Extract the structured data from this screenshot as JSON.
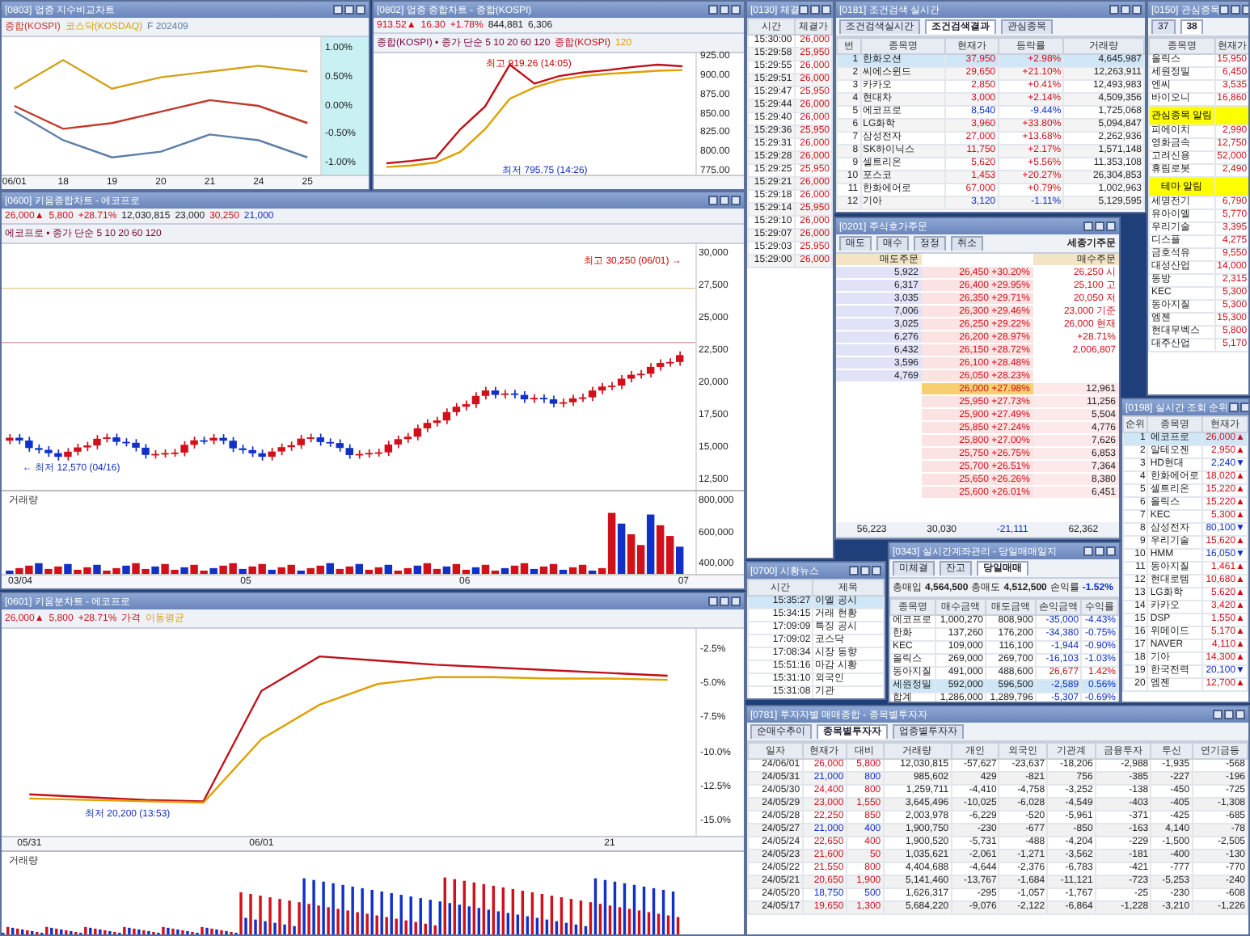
{
  "compare_chart": {
    "title": "[0803] 업종 지수비교차트",
    "chart_data": {
      "type": "line",
      "categories": [
        "06/01",
        "18",
        "19",
        "20",
        "21",
        "24",
        "25"
      ],
      "ylim": [
        -1.2,
        1.2
      ],
      "yticks": [
        {
          "value": 1,
          "label": "1.00%"
        },
        {
          "value": 0.5,
          "label": "0.50%"
        },
        {
          "value": 0,
          "label": "0.00%"
        },
        {
          "value": -0.5,
          "label": "-0.50%"
        },
        {
          "value": -1,
          "label": "-1.00%"
        }
      ],
      "series": [
        {
          "name": "종합(KOSPI)",
          "color": "#c0392b",
          "values": [
            0.0,
            -0.4,
            -0.3,
            -0.1,
            0.1,
            0.0,
            -0.3
          ]
        },
        {
          "name": "코스닥(KOSDAQ)",
          "color": "#d4a017",
          "values": [
            0.3,
            0.8,
            0.3,
            0.5,
            0.6,
            0.7,
            0.6
          ]
        },
        {
          "name": "F 202409",
          "color": "#5d7fa6",
          "values": [
            -0.1,
            -0.6,
            -0.9,
            -0.8,
            -0.5,
            -0.6,
            -0.9
          ]
        }
      ]
    }
  },
  "index_chart": {
    "title": "[0802] 업종 종합차트 - 종합(KOSPI)",
    "quote": [
      "913.52▲",
      "16.30",
      "+1.78%",
      "844,881",
      "6,306"
    ],
    "legend": "종합(KOSPI) ▪ 종가 단순 5 10 20 60 120",
    "high": "최고 919.26 (14:05)",
    "low": "최저 795.75 (14:26)",
    "chart_data": {
      "type": "line",
      "categories": [
        null,
        null,
        null,
        null,
        null,
        null,
        null,
        null,
        null,
        null,
        null,
        null,
        null
      ],
      "ylim": [
        770,
        930
      ],
      "yticks": [
        {
          "value": 925,
          "label": "925.00"
        },
        {
          "value": 900,
          "label": "900.00"
        },
        {
          "value": 875,
          "label": "875.00"
        },
        {
          "value": 850,
          "label": "850.00"
        },
        {
          "value": 825,
          "label": "825.00"
        },
        {
          "value": 800,
          "label": "800.00"
        },
        {
          "value": 775,
          "label": "775.00"
        }
      ],
      "series": [
        {
          "name": "종합(KOSPI)",
          "color": "#c0101a",
          "values": [
            785,
            788,
            792,
            830,
            860,
            915,
            890,
            900,
            905,
            908,
            912,
            915,
            913
          ]
        },
        {
          "name": "120",
          "color": "#e0a000",
          "values": [
            780,
            782,
            786,
            800,
            830,
            870,
            885,
            895,
            900,
            903,
            905,
            907,
            908
          ]
        }
      ]
    }
  },
  "stock_chart": {
    "title": "[0600] 키움종합차트 - 에코프로",
    "quote": [
      "26,000▲",
      "5,800",
      "+28.71%",
      "12,030,815",
      "23,000",
      "30,250",
      "21,000"
    ],
    "legend": "에코프로 ▪ 종가 단순 5 10 20 60 120",
    "yticks": [
      "30,000",
      "27,500",
      "25,000",
      "22,500",
      "20,000",
      "17,500",
      "15,000",
      "12,500"
    ],
    "high": "최고 30,250 (06/01) →",
    "low": "← 최저 12,570 (04/16)",
    "volume_label": "거래량",
    "volume_ticks": [
      "800,000",
      "600,000",
      "400,000"
    ],
    "xticks": [
      "03/04",
      "05",
      "06",
      "07"
    ]
  },
  "minute_chart": {
    "title": "[0601] 키움분차트 - 에코프로",
    "quote": [
      "26,000▲",
      "5,800",
      "+28.71%"
    ],
    "low": "최저 20,200 (13:53)",
    "volume_label": "거래량",
    "chart_data": {
      "type": "line",
      "categories": [
        "05/31",
        null,
        null,
        null,
        "06/01",
        null,
        null,
        null,
        null,
        null,
        "21",
        null
      ],
      "ylim": [
        -16,
        -1
      ],
      "yticks": [
        {
          "value": -2.5,
          "label": "-2.5%"
        },
        {
          "value": -5,
          "label": "-5.0%"
        },
        {
          "value": -7.5,
          "label": "-7.5%"
        },
        {
          "value": -10,
          "label": "-10.0%"
        },
        {
          "value": -12.5,
          "label": "-12.5%"
        },
        {
          "value": -15,
          "label": "-15.0%"
        }
      ],
      "series": [
        {
          "name": "가격",
          "color": "#c0101a",
          "values": [
            -13.0,
            -13.2,
            -13.4,
            -13.5,
            -5.5,
            -3.0,
            -3.3,
            -3.6,
            -3.8,
            -4.0,
            -4.2,
            -4.4
          ]
        },
        {
          "name": "이동평균",
          "color": "#e0a000",
          "values": [
            -13.3,
            -13.4,
            -13.5,
            -13.6,
            -9.0,
            -6.5,
            -5.0,
            -4.5,
            -4.5,
            -4.6,
            -4.6,
            -4.7
          ]
        }
      ]
    }
  },
  "trades": {
    "title": "[0130] 체결",
    "columns": [
      "시간",
      "체결가"
    ],
    "rows": [
      [
        "15:30:00",
        "26,000"
      ],
      [
        "15:29:58",
        "25,950"
      ],
      [
        "15:29:55",
        "26,000"
      ],
      [
        "15:29:51",
        "26,000"
      ],
      [
        "15:29:47",
        "25,950"
      ],
      [
        "15:29:44",
        "26,000"
      ],
      [
        "15:29:40",
        "26,000"
      ],
      [
        "15:29:36",
        "25,950"
      ],
      [
        "15:29:31",
        "26,000"
      ],
      [
        "15:29:28",
        "26,000"
      ],
      [
        "15:29:25",
        "25,950"
      ],
      [
        "15:29:21",
        "26,000"
      ],
      [
        "15:29:18",
        "26,000"
      ],
      [
        "15:29:14",
        "25,950"
      ],
      [
        "15:29:10",
        "26,000"
      ],
      [
        "15:29:07",
        "26,000"
      ],
      [
        "15:29:03",
        "25,950"
      ],
      [
        "15:29:00",
        "26,000"
      ]
    ]
  },
  "ranking": {
    "title": "[0181] 조건검색 실시간",
    "tabs": [
      {
        "label": "조건검색실시간",
        "selected": false
      },
      {
        "label": "조건검색결과",
        "selected": true
      },
      {
        "label": "관심종목",
        "selected": false
      }
    ],
    "columns": [
      "번",
      "종목명",
      "현재가",
      "등락률",
      "거래량"
    ],
    "rows": [
      {
        "cells": [
          "1",
          "한화오션",
          "37,950",
          "+2.98%",
          "4,645,987"
        ],
        "color": "#d0101a",
        "selected": true
      },
      {
        "cells": [
          "2",
          "씨에스윈드",
          "29,650",
          "+21.10%",
          "12,263,911"
        ],
        "color": "#d0101a",
        "selected": false
      },
      {
        "cells": [
          "3",
          "카카오",
          "2,850",
          "+0.41%",
          "12,493,983"
        ],
        "color": "#d0101a",
        "selected": false
      },
      {
        "cells": [
          "4",
          "현대차",
          "3,000",
          "+2.14%",
          "4,509,356"
        ],
        "color": "#d0101a",
        "selected": false
      },
      {
        "cells": [
          "5",
          "에코프로",
          "8,540",
          "-9.44%",
          "1,725,068"
        ],
        "color": "#1030c8",
        "selected": false
      },
      {
        "cells": [
          "6",
          "LG화학",
          "3,960",
          "+33.80%",
          "5,094,847"
        ],
        "color": "#d0101a",
        "selected": false
      },
      {
        "cells": [
          "7",
          "삼성전자",
          "27,000",
          "+13.68%",
          "2,262,936"
        ],
        "color": "#d0101a",
        "selected": false
      },
      {
        "cells": [
          "8",
          "SK하이닉스",
          "11,750",
          "+2.17%",
          "1,571,148"
        ],
        "color": "#d0101a",
        "selected": false
      },
      {
        "cells": [
          "9",
          "셀트리온",
          "5,620",
          "+5.56%",
          "11,353,108"
        ],
        "color": "#d0101a",
        "selected": false
      },
      {
        "cells": [
          "10",
          "포스코",
          "1,453",
          "+20.27%",
          "26,304,853"
        ],
        "color": "#d0101a",
        "selected": false
      },
      {
        "cells": [
          "11",
          "한화에어로",
          "67,000",
          "+0.79%",
          "1,002,963"
        ],
        "color": "#d0101a",
        "selected": false
      },
      {
        "cells": [
          "12",
          "기아",
          "3,120",
          "-1.11%",
          "5,129,595"
        ],
        "color": "#1030c8",
        "selected": false
      }
    ]
  },
  "watchlist": {
    "title": "[0150] 관심종목",
    "tabs": [
      {
        "label": "37",
        "selected": false
      },
      {
        "label": "38",
        "selected": true
      }
    ],
    "columns": [
      "종목명",
      "현재가"
    ],
    "rows": [
      {
        "kind": "stock",
        "cells": [
          "올릭스",
          "15,950"
        ],
        "color": "#d0101a"
      },
      {
        "kind": "stock",
        "cells": [
          "세원정밀",
          "6,450"
        ],
        "color": "#d0101a"
      },
      {
        "kind": "stock",
        "cells": [
          "엔씨",
          "3,535"
        ],
        "color": "#d0101a"
      },
      {
        "kind": "stock",
        "cells": [
          "바이오니",
          "16,860"
        ],
        "color": "#d0101a"
      },
      {
        "kind": "banner",
        "cells": [
          "관심종목 알림"
        ]
      },
      {
        "kind": "stock",
        "cells": [
          "피에이치",
          "2,990"
        ],
        "color": "#d0101a"
      },
      {
        "kind": "stock",
        "cells": [
          "영화금속",
          "12,750"
        ],
        "color": "#d0101a"
      },
      {
        "kind": "stock",
        "cells": [
          "고려신용",
          "52,000"
        ],
        "color": "#d0101a"
      },
      {
        "kind": "stock",
        "cells": [
          "휴림로봇",
          "2,490"
        ],
        "color": "#d0101a"
      },
      {
        "kind": "banner",
        "cells": [
          "테마 알림"
        ]
      },
      {
        "kind": "stock",
        "cells": [
          "세명전기",
          "6,790"
        ],
        "color": "#d0101a"
      },
      {
        "kind": "stock",
        "cells": [
          "유아이엘",
          "5,770"
        ],
        "color": "#d0101a"
      },
      {
        "kind": "stock",
        "cells": [
          "우리기술",
          "3,395"
        ],
        "color": "#d0101a"
      },
      {
        "kind": "stock",
        "cells": [
          "디스플",
          "4,275"
        ],
        "color": "#d0101a"
      },
      {
        "kind": "stock",
        "cells": [
          "금호석유",
          "9,550"
        ],
        "color": "#d0101a"
      },
      {
        "kind": "stock",
        "cells": [
          "대성산업",
          "14,000"
        ],
        "color": "#d0101a"
      },
      {
        "kind": "stock",
        "cells": [
          "동방",
          "2,315"
        ],
        "color": "#d0101a"
      },
      {
        "kind": "stock",
        "cells": [
          "KEC",
          "5,300"
        ],
        "color": "#d0101a"
      },
      {
        "kind": "stock",
        "cells": [
          "동아지질",
          "5,300"
        ],
        "color": "#d0101a"
      },
      {
        "kind": "stock",
        "cells": [
          "엠젠",
          "15,300"
        ],
        "color": "#d0101a"
      },
      {
        "kind": "stock",
        "cells": [
          "현대무벡스",
          "5,800"
        ],
        "color": "#d0101a"
      },
      {
        "kind": "stock",
        "cells": [
          "대주산업",
          "5,170"
        ],
        "color": "#d0101a"
      }
    ]
  },
  "order_book": {
    "title": "[0201] 주식호가주문",
    "tabs": [
      "매도",
      "매수",
      "정정",
      "취소"
    ],
    "header": "세종기주문",
    "ask_label": "매도주문",
    "bid_label": "매수주문",
    "asks": [
      [
        "26,450",
        "+30.20%"
      ],
      [
        "26,400",
        "+29.95%"
      ],
      [
        "26,350",
        "+29.71%"
      ],
      [
        "26,300",
        "+29.46%"
      ],
      [
        "26,250",
        "+29.22%"
      ],
      [
        "26,200",
        "+28.97%"
      ],
      [
        "26,150",
        "+28.72%"
      ],
      [
        "26,100",
        "+28.48%"
      ],
      [
        "26,050",
        "+28.23%"
      ]
    ],
    "ask_qty": [
      "5,922",
      "6,317",
      "3,035",
      "7,006",
      "3,025",
      "6,276",
      "6,432",
      "3,596",
      "4,769"
    ],
    "bids": [
      [
        "26,000",
        "+27.98%"
      ],
      [
        "25,950",
        "+27.73%"
      ],
      [
        "25,900",
        "+27.49%"
      ],
      [
        "25,850",
        "+27.24%"
      ],
      [
        "25,800",
        "+27.00%"
      ],
      [
        "25,750",
        "+26.75%"
      ],
      [
        "25,700",
        "+26.51%"
      ],
      [
        "25,650",
        "+26.26%"
      ],
      [
        "25,600",
        "+26.01%"
      ]
    ],
    "bid_qty": [
      "12,961",
      "11,256",
      "5,504",
      "4,776",
      "7,626",
      "6,853",
      "7,364",
      "8,380",
      "6,451"
    ],
    "info": [
      "26,250 시",
      "25,100 고",
      "20,050 저",
      "23,000 기준",
      "26,000 현재",
      "+28.71%",
      "2,006,807"
    ],
    "totals": [
      "56,223",
      "30,030",
      "-21,111",
      "62,362"
    ]
  },
  "popular": {
    "title": "[0198] 실시간 조회 순위",
    "columns": [
      "순위",
      "종목명",
      "현재가"
    ],
    "rows": [
      {
        "cells": [
          "1",
          "에코프로",
          "26,000▲"
        ],
        "color": "#d0101a",
        "selected": true
      },
      {
        "cells": [
          "2",
          "알테오젠",
          "2,950▲"
        ],
        "color": "#d0101a",
        "selected": false
      },
      {
        "cells": [
          "3",
          "HD현대",
          "2,240▼"
        ],
        "color": "#1030c8",
        "selected": false
      },
      {
        "cells": [
          "4",
          "한화에어로",
          "18,020▲"
        ],
        "color": "#d0101a",
        "selected": false
      },
      {
        "cells": [
          "5",
          "셀트리온",
          "15,220▲"
        ],
        "color": "#d0101a",
        "selected": false
      },
      {
        "cells": [
          "6",
          "올릭스",
          "15,220▲"
        ],
        "color": "#d0101a",
        "selected": false
      },
      {
        "cells": [
          "7",
          "KEC",
          "5,300▲"
        ],
        "color": "#d0101a",
        "selected": false
      },
      {
        "cells": [
          "8",
          "삼성전자",
          "80,100▼"
        ],
        "color": "#1030c8",
        "selected": false
      },
      {
        "cells": [
          "9",
          "우리기술",
          "15,620▲"
        ],
        "color": "#d0101a",
        "selected": false
      },
      {
        "cells": [
          "10",
          "HMM",
          "16,050▼"
        ],
        "color": "#1030c8",
        "selected": false
      },
      {
        "cells": [
          "11",
          "동아지질",
          "1,461▲"
        ],
        "color": "#d0101a",
        "selected": false
      },
      {
        "cells": [
          "12",
          "현대로템",
          "10,680▲"
        ],
        "color": "#d0101a",
        "selected": false
      },
      {
        "cells": [
          "13",
          "LG화학",
          "5,620▲"
        ],
        "color": "#d0101a",
        "selected": false
      },
      {
        "cells": [
          "14",
          "카카오",
          "3,420▲"
        ],
        "color": "#d0101a",
        "selected": false
      },
      {
        "cells": [
          "15",
          "DSP",
          "1,550▲"
        ],
        "color": "#d0101a",
        "selected": false
      },
      {
        "cells": [
          "16",
          "위메이드",
          "5,170▲"
        ],
        "color": "#d0101a",
        "selected": false
      },
      {
        "cells": [
          "17",
          "NAVER",
          "4,110▲"
        ],
        "color": "#d0101a",
        "selected": false
      },
      {
        "cells": [
          "18",
          "기아",
          "14,300▲"
        ],
        "color": "#d0101a",
        "selected": false
      },
      {
        "cells": [
          "19",
          "한국전력",
          "20,100▼"
        ],
        "color": "#1030c8",
        "selected": false
      },
      {
        "cells": [
          "20",
          "엠젠",
          "12,700▲"
        ],
        "color": "#d0101a",
        "selected": false
      }
    ]
  },
  "news": {
    "title": "[0700] 시황뉴스",
    "columns": [
      "시간",
      "제목"
    ],
    "rows": [
      {
        "cells": [
          "15:35:27",
          "이엘 공시"
        ],
        "selected": true
      },
      {
        "cells": [
          "15:34:15",
          "거래 현황"
        ],
        "selected": false
      },
      {
        "cells": [
          "17:09:09",
          "특징 공시"
        ],
        "selected": false
      },
      {
        "cells": [
          "17:09:02",
          "코스닥"
        ],
        "selected": false
      },
      {
        "cells": [
          "17:08:34",
          "시장 동향"
        ],
        "selected": false
      },
      {
        "cells": [
          "15:51:16",
          "마감 시황"
        ],
        "selected": false
      },
      {
        "cells": [
          "15:31:10",
          "외국인"
        ],
        "selected": false
      },
      {
        "cells": [
          "15:31:08",
          "기관"
        ],
        "selected": false
      }
    ]
  },
  "balance": {
    "title": "[0343] 실시간계좌관리 - 당일매매일지",
    "tabs": [
      {
        "label": "미체결",
        "selected": false
      },
      {
        "label": "잔고",
        "selected": false
      },
      {
        "label": "당일매매",
        "selected": true
      }
    ],
    "summary": [
      [
        "총매입",
        "4,564,500"
      ],
      [
        "총매도",
        "4,512,500"
      ],
      [
        "손익률",
        "-1.52%"
      ]
    ],
    "columns": [
      "종목명",
      "매수금액",
      "매도금액",
      "손익금액",
      "수익률"
    ],
    "rows": [
      {
        "cells": [
          "에코프로",
          "1,000,270",
          "808,900",
          "-35,000",
          "-4.43%"
        ],
        "color": "#1030c8",
        "selected": false
      },
      {
        "cells": [
          "한화",
          "137,260",
          "176,200",
          "-34,380",
          "-0.75%"
        ],
        "color": "#1030c8",
        "selected": false
      },
      {
        "cells": [
          "KEC",
          "109,000",
          "116,100",
          "-1,944",
          "-0.90%"
        ],
        "color": "#1030c8",
        "selected": false
      },
      {
        "cells": [
          "올릭스",
          "269,000",
          "269,700",
          "-16,103",
          "-1.03%"
        ],
        "color": "#1030c8",
        "selected": false
      },
      {
        "cells": [
          "동아지질",
          "491,000",
          "488,600",
          "26,677",
          "1.42%"
        ],
        "color": "#d0101a",
        "selected": false
      },
      {
        "cells": [
          "세원정밀",
          "592,000",
          "596,500",
          "-2,589",
          "0.56%"
        ],
        "color": "#1030c8",
        "selected": true
      },
      {
        "cells": [
          "합계",
          "1,286,000",
          "1,289,796",
          "-5,307",
          "-0.69%"
        ],
        "color": "#1030c8",
        "selected": false
      }
    ]
  },
  "investor": {
    "title": "[0781] 투자자별 매매종합 - 종목별투자자",
    "tabs": [
      {
        "label": "순매수추이",
        "selected": false
      },
      {
        "label": "종목별투자자",
        "selected": true
      },
      {
        "label": "업종별투자자",
        "selected": false
      }
    ],
    "columns": [
      "일자",
      "현재가",
      "대비",
      "거래량",
      "개인",
      "외국인",
      "기관계",
      "금융투자",
      "투신",
      "연기금등"
    ],
    "rows": [
      {
        "cells": [
          "24/06/01",
          "26,000",
          "5,800",
          "12,030,815",
          "-57,627",
          "-23,637",
          "-18,206",
          "-2,988",
          "-1,935",
          "-568"
        ],
        "color": "#d0101a"
      },
      {
        "cells": [
          "24/05/31",
          "21,000",
          "800",
          "985,602",
          "429",
          "-821",
          "756",
          "-385",
          "-227",
          "-196"
        ],
        "color": "#1030c8"
      },
      {
        "cells": [
          "24/05/30",
          "24,400",
          "800",
          "1,259,711",
          "-4,410",
          "-4,758",
          "-3,252",
          "-138",
          "-450",
          "-725"
        ],
        "color": "#d0101a"
      },
      {
        "cells": [
          "24/05/29",
          "23,000",
          "1,550",
          "3,645,496",
          "-10,025",
          "-6,028",
          "-4,549",
          "-403",
          "-405",
          "-1,308"
        ],
        "color": "#d0101a"
      },
      {
        "cells": [
          "24/05/28",
          "22,250",
          "850",
          "2,003,978",
          "-6,229",
          "-520",
          "-5,961",
          "-371",
          "-425",
          "-685"
        ],
        "color": "#d0101a"
      },
      {
        "cells": [
          "24/05/27",
          "21,000",
          "400",
          "1,900,750",
          "-230",
          "-677",
          "-850",
          "-163",
          "4,140",
          "-78"
        ],
        "color": "#1030c8"
      },
      {
        "cells": [
          "24/05/24",
          "22,650",
          "400",
          "1,900,520",
          "-5,731",
          "-488",
          "-4,204",
          "-229",
          "-1,500",
          "-2,505"
        ],
        "color": "#d0101a"
      },
      {
        "cells": [
          "24/05/23",
          "21,600",
          "50",
          "1,035,621",
          "-2,061",
          "-1,271",
          "-3,562",
          "-181",
          "-400",
          "-130"
        ],
        "color": "#d0101a"
      },
      {
        "cells": [
          "24/05/22",
          "21,550",
          "800",
          "4,404,688",
          "-4,644",
          "-2,376",
          "-6,783",
          "-421",
          "-777",
          "-770"
        ],
        "color": "#d0101a"
      },
      {
        "cells": [
          "24/05/21",
          "20,650",
          "1,900",
          "5,141,460",
          "-13,767",
          "-1,684",
          "-11,121",
          "-723",
          "-5,253",
          "-240"
        ],
        "color": "#d0101a"
      },
      {
        "cells": [
          "24/05/20",
          "18,750",
          "500",
          "1,626,317",
          "-295",
          "-1,057",
          "-1,767",
          "-25",
          "-230",
          "-608"
        ],
        "color": "#1030c8"
      },
      {
        "cells": [
          "24/05/17",
          "19,650",
          "1,300",
          "5,684,220",
          "-9,076",
          "-2,122",
          "-6,864",
          "-1,228",
          "-3,210",
          "-1,226"
        ],
        "color": "#d0101a"
      }
    ]
  }
}
